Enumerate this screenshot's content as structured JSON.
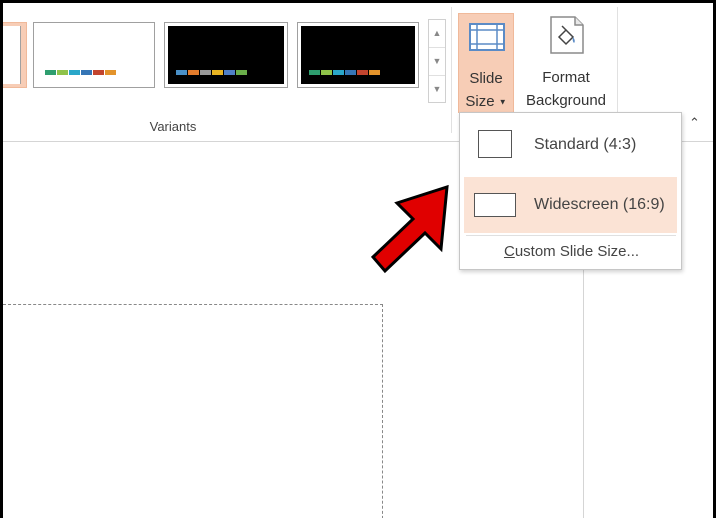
{
  "ribbon": {
    "variants_label": "Variants",
    "slide_size": {
      "line1": "Slide",
      "line2": "Size"
    },
    "format_background": {
      "line1": "Format",
      "line2": "Background"
    }
  },
  "variants": [
    {
      "background": "#ffffff",
      "swatches": [
        "#2e9e6f",
        "#8fc34a",
        "#2aa7c9",
        "#3575b5",
        "#c2442e",
        "#e3932b"
      ]
    },
    {
      "background": "#000000",
      "swatches": [
        "#4a90c7",
        "#e37c2c",
        "#9a9a9a",
        "#e8b422",
        "#4f7fc6",
        "#6aae4a"
      ]
    },
    {
      "background": "#000000",
      "swatches": [
        "#2e9e6f",
        "#8fc34a",
        "#2aa7c9",
        "#3575b5",
        "#c2442e",
        "#e3932b"
      ]
    }
  ],
  "dropdown": {
    "items": [
      {
        "label": "Standard (4:3)",
        "selected": false
      },
      {
        "label": "Widescreen (16:9)",
        "selected": true
      }
    ],
    "custom": {
      "accel": "C",
      "rest": "ustom Slide Size..."
    }
  },
  "colors": {
    "accent_highlight": "#f7cdb6",
    "arrow_fill": "#e00000"
  },
  "icons": {
    "slide_size": "slide-size-icon",
    "format_background": "format-background-icon",
    "collapse": "chevron-up-icon",
    "callout": "red-arrow-icon"
  }
}
